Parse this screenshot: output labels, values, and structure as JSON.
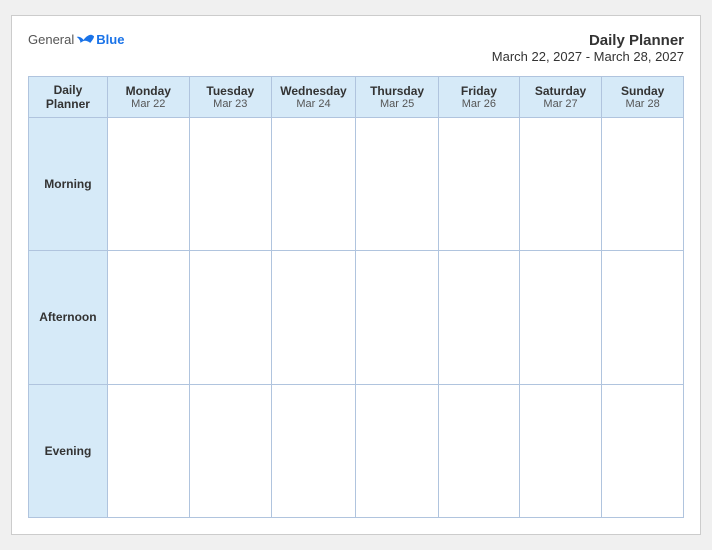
{
  "logo": {
    "general": "General",
    "blue": "Blue"
  },
  "title": {
    "main": "Daily Planner",
    "sub": "March 22, 2027 - March 28, 2027"
  },
  "columns": [
    {
      "id": "label",
      "dayName": "Daily",
      "dayName2": "Planner",
      "date": ""
    },
    {
      "id": "mon",
      "dayName": "Monday",
      "date": "Mar 22"
    },
    {
      "id": "tue",
      "dayName": "Tuesday",
      "date": "Mar 23"
    },
    {
      "id": "wed",
      "dayName": "Wednesday",
      "date": "Mar 24"
    },
    {
      "id": "thu",
      "dayName": "Thursday",
      "date": "Mar 25"
    },
    {
      "id": "fri",
      "dayName": "Friday",
      "date": "Mar 26"
    },
    {
      "id": "sat",
      "dayName": "Saturday",
      "date": "Mar 27"
    },
    {
      "id": "sun",
      "dayName": "Sunday",
      "date": "Mar 28"
    }
  ],
  "rows": [
    {
      "id": "morning",
      "label": "Morning"
    },
    {
      "id": "afternoon",
      "label": "Afternoon"
    },
    {
      "id": "evening",
      "label": "Evening"
    }
  ]
}
